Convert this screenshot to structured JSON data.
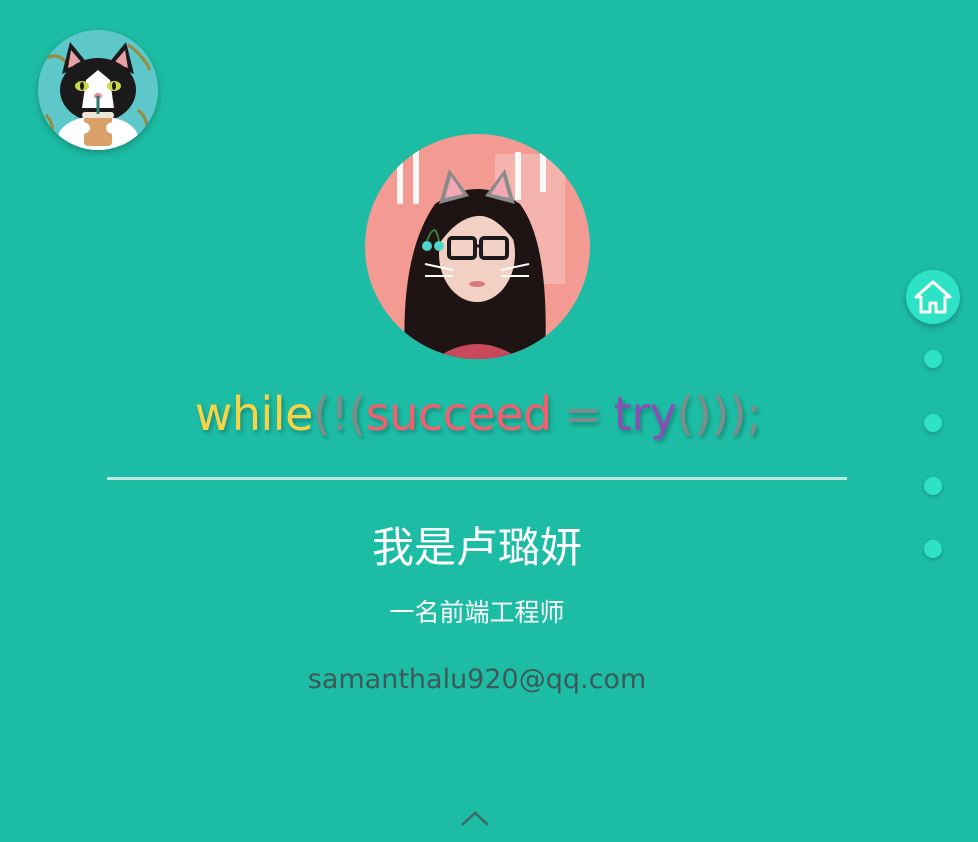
{
  "logo": {
    "icon": "cat-with-drink-icon"
  },
  "profile": {
    "avatar_icon": "cat-ears-portrait-icon"
  },
  "motto": {
    "while": "while",
    "open1": "(",
    "bang": "!",
    "open2": "(",
    "succeed": "succeed",
    "eq": "=",
    "try": "try",
    "close": "()));"
  },
  "person": {
    "name": "我是卢璐妍",
    "role": "一名前端工程师",
    "email": "samanthalu920@qq.com"
  },
  "nav": {
    "home_icon": "home-icon",
    "dots": 4
  },
  "colors": {
    "background": "#1dbda5",
    "accent": "#2ee3c5",
    "motto_while": "#f5d547",
    "motto_succeed": "#f0606f",
    "motto_try": "#8a4fb4"
  }
}
